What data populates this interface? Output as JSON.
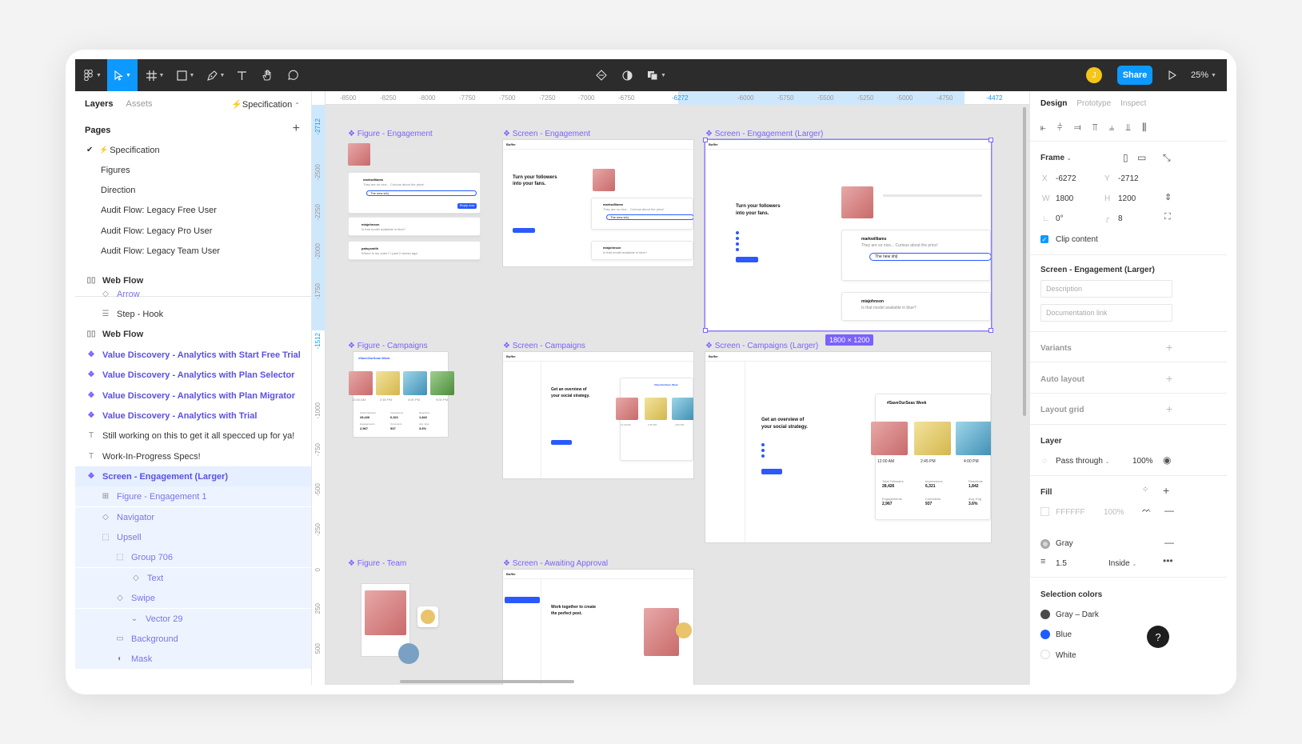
{
  "toolbar": {
    "share_label": "Share",
    "zoom_label": "25%",
    "user_initial": "J",
    "colors": {
      "bg": "#2c2c2c",
      "accent": "#0d99ff"
    }
  },
  "left_panel": {
    "tabs": [
      "Layers",
      "Assets"
    ],
    "page_selector": "Specification",
    "pages_heading": "Pages",
    "pages": [
      "Specification",
      "Figures",
      "Direction",
      "Audit Flow: Legacy Free User",
      "Audit Flow: Legacy Pro User",
      "Audit Flow: Legacy Team User"
    ],
    "layers": [
      "Web Flow",
      "Arrow",
      "Step - Hook",
      "Web Flow",
      "Value Discovery - Analytics with Start Free Trial",
      "Value Discovery - Analytics with Plan Selector",
      "Value Discovery - Analytics with Plan Migrator",
      "Value Discovery - Analytics with Trial",
      "Still working on this to get it all specced up for ya!",
      "Work-In-Progress Specs!",
      "Screen - Engagement (Larger)",
      "Figure - Engagement 1",
      "Navigator",
      "Upsell",
      "Group 706",
      "Text",
      "Swipe",
      "Vector 29",
      "Background",
      "Mask"
    ]
  },
  "canvas": {
    "ruler_x": [
      "-8500",
      "-8250",
      "-8000",
      "-7750",
      "-7500",
      "-7250",
      "-7000",
      "-6750",
      "-6272",
      "-6000",
      "-5750",
      "-5500",
      "-5250",
      "-5000",
      "-4750",
      "-4472"
    ],
    "ruler_y": [
      "-2712",
      "-2500",
      "-2250",
      "-2000",
      "-1750",
      "-1512",
      "-1000",
      "-750",
      "-500",
      "-250",
      "0",
      "250",
      "500"
    ],
    "frames": {
      "fig_engagement": "Figure - Engagement",
      "scr_engagement": "Screen - Engagement",
      "scr_engagement_large": "Screen - Engagement (Larger)",
      "fig_campaigns": "Figure - Campaigns",
      "scr_campaigns": "Screen - Campaigns",
      "scr_campaigns_large": "Screen - Campaigns (Larger)",
      "fig_team": "Figure - Team",
      "scr_awaiting": "Screen - Awaiting Approval"
    },
    "selection_size": "1800 × 1200",
    "mock": {
      "brand": "Buffer",
      "engagement_heading_1": "Turn your followers",
      "engagement_heading_2": "into your fans.",
      "campaigns_heading_1": "Get an overview of",
      "campaigns_heading_2": "your social strategy.",
      "awaiting_heading_1": "Work together to create",
      "awaiting_heading_2": "the perfect post.",
      "commenter_1": "markwilliams",
      "comment_time_1": "· 13 min",
      "comment_1": "They are so nice... Curious about the price!",
      "reply_text": "The new shi|",
      "commenter_2": "miajohnson",
      "comment_time_2": "· 13 min",
      "comment_2": "Is that model available in blue?",
      "reply_button": "Reply now",
      "commenter_3": "patsysmith",
      "comment_3": "Where is my order? I paid 2 weeks ago!",
      "campaign_tag": "#SaveOurSeas Week",
      "time_1": "12:00 AM",
      "time_2": "2:45 PM",
      "time_3": "4:00 PM",
      "time_4": "9:00 PM",
      "stat_1_label": "Total Followers",
      "stat_1_value": "28,426",
      "stat_2_label": "Impressions",
      "stat_2_value": "6,321",
      "stat_3_label": "Reactions",
      "stat_3_value": "1,842",
      "stat_4_label": "Engagements",
      "stat_4_value": "2,967",
      "stat_5_label": "Comments",
      "stat_5_value": "937",
      "stat_6_label": "Avg. Eng",
      "stat_6_value": "3.6%"
    }
  },
  "right_panel": {
    "tabs": [
      "Design",
      "Prototype",
      "Inspect"
    ],
    "frame_label": "Frame",
    "x_label": "X",
    "x_value": "-6272",
    "y_label": "Y",
    "y_value": "-2712",
    "w_label": "W",
    "w_value": "1800",
    "h_label": "H",
    "h_value": "1200",
    "rotation": "0°",
    "radius": "8",
    "clip_content": "Clip content",
    "component_name": "Screen - Engagement (Larger)",
    "description_placeholder": "Description",
    "doc_link_placeholder": "Documentation link",
    "variants": "Variants",
    "auto_layout": "Auto layout",
    "layout_grid": "Layout grid",
    "layer_heading": "Layer",
    "blend_mode": "Pass through",
    "layer_opacity": "100%",
    "fill_heading": "Fill",
    "fill_hex": "FFFFFF",
    "fill_opacity": "100%",
    "stroke_color_name": "Gray",
    "stroke_width": "1.5",
    "stroke_position": "Inside",
    "selection_colors_heading": "Selection colors",
    "selection_colors": [
      {
        "name": "Gray – Dark",
        "hex": "#4a4a4a"
      },
      {
        "name": "Blue",
        "hex": "#1f5bff"
      },
      {
        "name": "White",
        "hex": "#ffffff"
      }
    ],
    "help_label": "?"
  }
}
